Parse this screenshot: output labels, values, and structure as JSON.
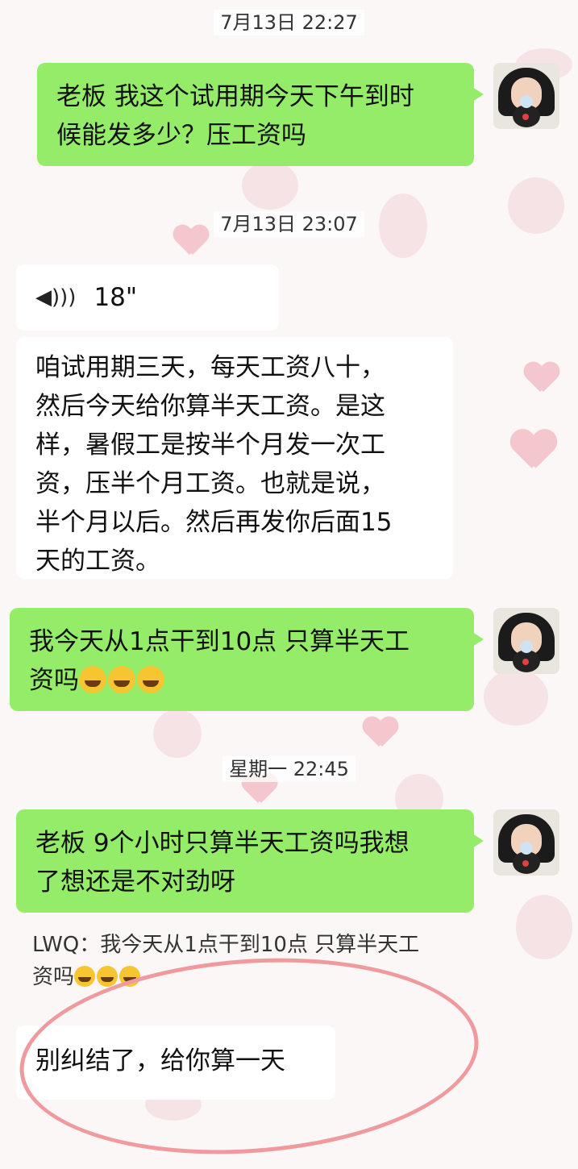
{
  "messages": [
    {
      "type": "timestamp",
      "text": "7月13日 22:27"
    },
    {
      "type": "sent",
      "text_lines": [
        "老板 我这个试用期今天下午到时",
        "候能发多少？压工资吗"
      ]
    },
    {
      "type": "timestamp",
      "text": "7月13日 23:07"
    },
    {
      "type": "voice",
      "duration": "18\""
    },
    {
      "type": "received",
      "text_lines": [
        "咱试用期三天，每天工资八十，",
        "然后今天给你算半天工资。是这",
        "样，暑假工是按半个月发一次工",
        "资，压半个月工资。也就是说，",
        "半个月以后。然后再发你后面15",
        "天的工资。"
      ]
    },
    {
      "type": "sent",
      "text_lines": [
        "我今天从1点干到10点 只算半天工",
        "资吗"
      ],
      "emoji": "face-with-tears-of-joy"
    },
    {
      "type": "timestamp",
      "text": "星期一 22:45"
    },
    {
      "type": "sent",
      "text_lines": [
        "老板 9个小时只算半天工资吗我想",
        "了想还是不对劲呀"
      ]
    },
    {
      "type": "quote",
      "text_lines": [
        "LWQ：我今天从1点干到10点 只算半天工",
        "资吗"
      ]
    },
    {
      "type": "received",
      "text_lines": [
        "别纠结了，给你算一天"
      ]
    }
  ],
  "colors": {
    "sent_bubble": "#95ec69",
    "received_bubble": "#ffffff",
    "highlight_circle": "#f09a9e"
  }
}
